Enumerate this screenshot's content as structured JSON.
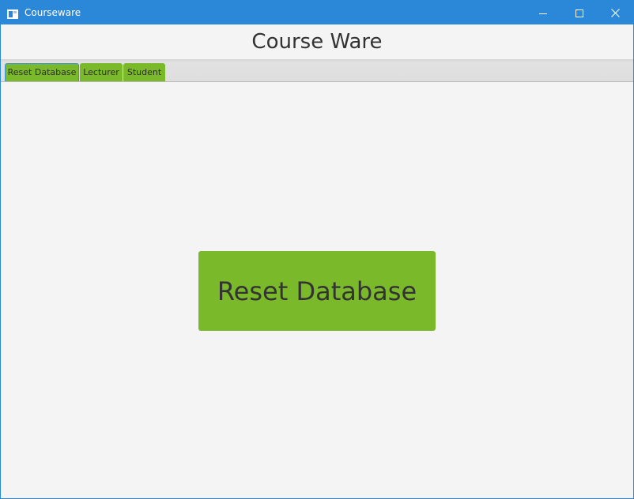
{
  "window": {
    "title": "Courseware",
    "accent_color": "#2b88d8",
    "controls": {
      "minimize_icon": "minimize-icon",
      "maximize_icon": "maximize-icon",
      "close_icon": "close-icon"
    }
  },
  "header": {
    "title": "Course Ware"
  },
  "tabs": [
    {
      "label": "Reset Database",
      "selected": true
    },
    {
      "label": "Lecturer",
      "selected": false
    },
    {
      "label": "Student",
      "selected": false
    }
  ],
  "main": {
    "reset_button_label": "Reset Database"
  },
  "colors": {
    "tab_green": "#7ab929",
    "button_green": "#7ab929",
    "background": "#f4f4f4",
    "selected_tab_border": "#3b8fd6"
  }
}
